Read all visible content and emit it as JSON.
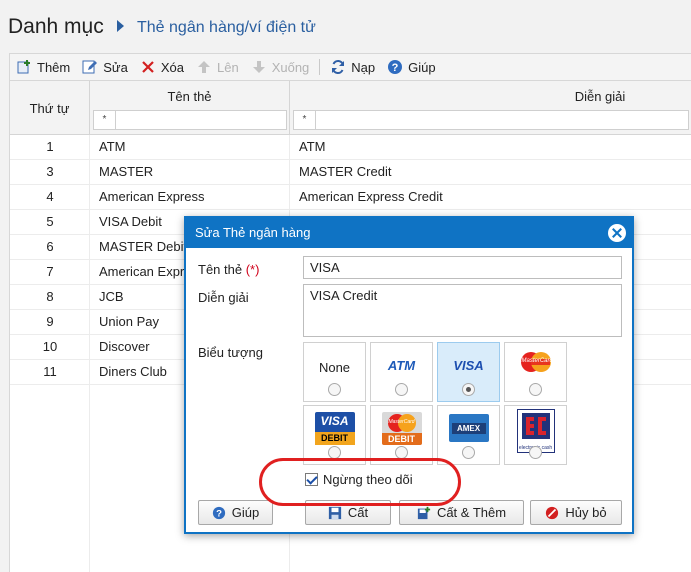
{
  "header": {
    "title": "Danh mục",
    "breadcrumb": "Thẻ ngân hàng/ví điện tử"
  },
  "toolbar": {
    "add": "Thêm",
    "edit": "Sửa",
    "delete": "Xóa",
    "up": "Lên",
    "down": "Xuống",
    "reload": "Nạp",
    "help": "Giúp"
  },
  "grid": {
    "columns": [
      "Thứ tự",
      "Tên thẻ",
      "Diễn giải"
    ],
    "filter_symbol": "*",
    "rows": [
      {
        "order": "1",
        "name": "ATM",
        "desc": "ATM"
      },
      {
        "order": "3",
        "name": "MASTER",
        "desc": "MASTER Credit"
      },
      {
        "order": "4",
        "name": "American Express",
        "desc": "American Express Credit"
      },
      {
        "order": "5",
        "name": "VISA Debit",
        "desc": ""
      },
      {
        "order": "6",
        "name": "MASTER Debit",
        "desc": ""
      },
      {
        "order": "7",
        "name": "American Expr",
        "desc": ""
      },
      {
        "order": "8",
        "name": "JCB",
        "desc": ""
      },
      {
        "order": "9",
        "name": "Union Pay",
        "desc": ""
      },
      {
        "order": "10",
        "name": "Discover",
        "desc": ""
      },
      {
        "order": "11",
        "name": "Diners Club",
        "desc": ""
      }
    ]
  },
  "dialog": {
    "title": "Sửa Thẻ ngân hàng",
    "name_label": "Tên thẻ",
    "required_mark": "(*)",
    "name_value": "VISA",
    "desc_label": "Diễn giải",
    "desc_value": "VISA Credit",
    "icon_label": "Biểu tượng",
    "icons": {
      "none": "None",
      "atm": "ATM",
      "visa": "VISA",
      "mastercard": "MasterCard",
      "visa_debit_top": "VISA",
      "visa_debit_bottom": "DEBIT",
      "master_debit_top": "MasterCard",
      "master_debit_bottom": "DEBIT",
      "amex": "AMEX",
      "electronic_cash": "electronic cash"
    },
    "selected_icon": "visa",
    "stop_tracking_label": "Ngừng theo dõi",
    "stop_tracking_checked": true,
    "buttons": {
      "help": "Giúp",
      "save": "Cất",
      "save_add": "Cất & Thêm",
      "cancel": "Hủy bỏ"
    }
  },
  "colors": {
    "accent": "#0f73c4",
    "breadcrumb": "#2a5fa0",
    "highlight": "#e02020"
  }
}
